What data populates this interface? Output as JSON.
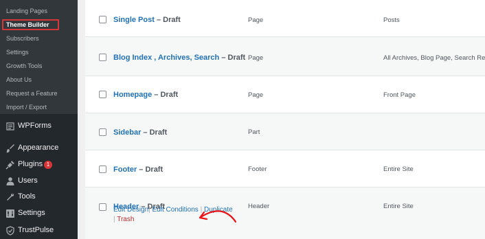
{
  "sidebar": {
    "submenu": [
      {
        "label": "Landing Pages"
      },
      {
        "label": "Theme Builder",
        "current": true
      },
      {
        "label": "Subscribers"
      },
      {
        "label": "Settings"
      },
      {
        "label": "Growth Tools"
      },
      {
        "label": "About Us"
      },
      {
        "label": "Request a Feature"
      },
      {
        "label": "Import / Export"
      }
    ],
    "menu": [
      {
        "label": "WPForms",
        "icon": "wpforms-icon"
      },
      {
        "label": "Appearance",
        "icon": "paintbrush-icon"
      },
      {
        "label": "Plugins",
        "icon": "plug-icon",
        "badge": "1"
      },
      {
        "label": "Users",
        "icon": "user-icon"
      },
      {
        "label": "Tools",
        "icon": "wrench-icon"
      },
      {
        "label": "Settings",
        "icon": "settings-icon"
      },
      {
        "label": "TrustPulse",
        "icon": "trustpulse-icon"
      }
    ]
  },
  "rows": [
    {
      "title": "Single Post",
      "status": " – Draft",
      "type": "Page",
      "condition": "Posts"
    },
    {
      "title": "Blog Index , Archives, Search",
      "status": " – Draft",
      "type": "Page",
      "condition": "All Archives, Blog Page, Search Re"
    },
    {
      "title": "Homepage",
      "status": " – Draft",
      "type": "Page",
      "condition": "Front Page"
    },
    {
      "title": "Sidebar",
      "status": " – Draft",
      "type": "Part",
      "condition": ""
    },
    {
      "title": "Footer",
      "status": " – Draft",
      "type": "Footer",
      "condition": "Entire Site"
    },
    {
      "title": "Header",
      "status": " – Draft",
      "type": "Header",
      "condition": "Entire Site"
    }
  ],
  "header_actions": {
    "edit_design": "Edit Design",
    "edit_conditions": "Edit Conditions",
    "duplicate": "Duplicate",
    "trash": "Trash",
    "separator": "|"
  },
  "colors": {
    "sidebar_bg": "#23282d",
    "submenu_bg": "#32373c",
    "link": "#2271b1",
    "highlight_box": "#d63638",
    "annotation_arrow": "#e8141b"
  }
}
